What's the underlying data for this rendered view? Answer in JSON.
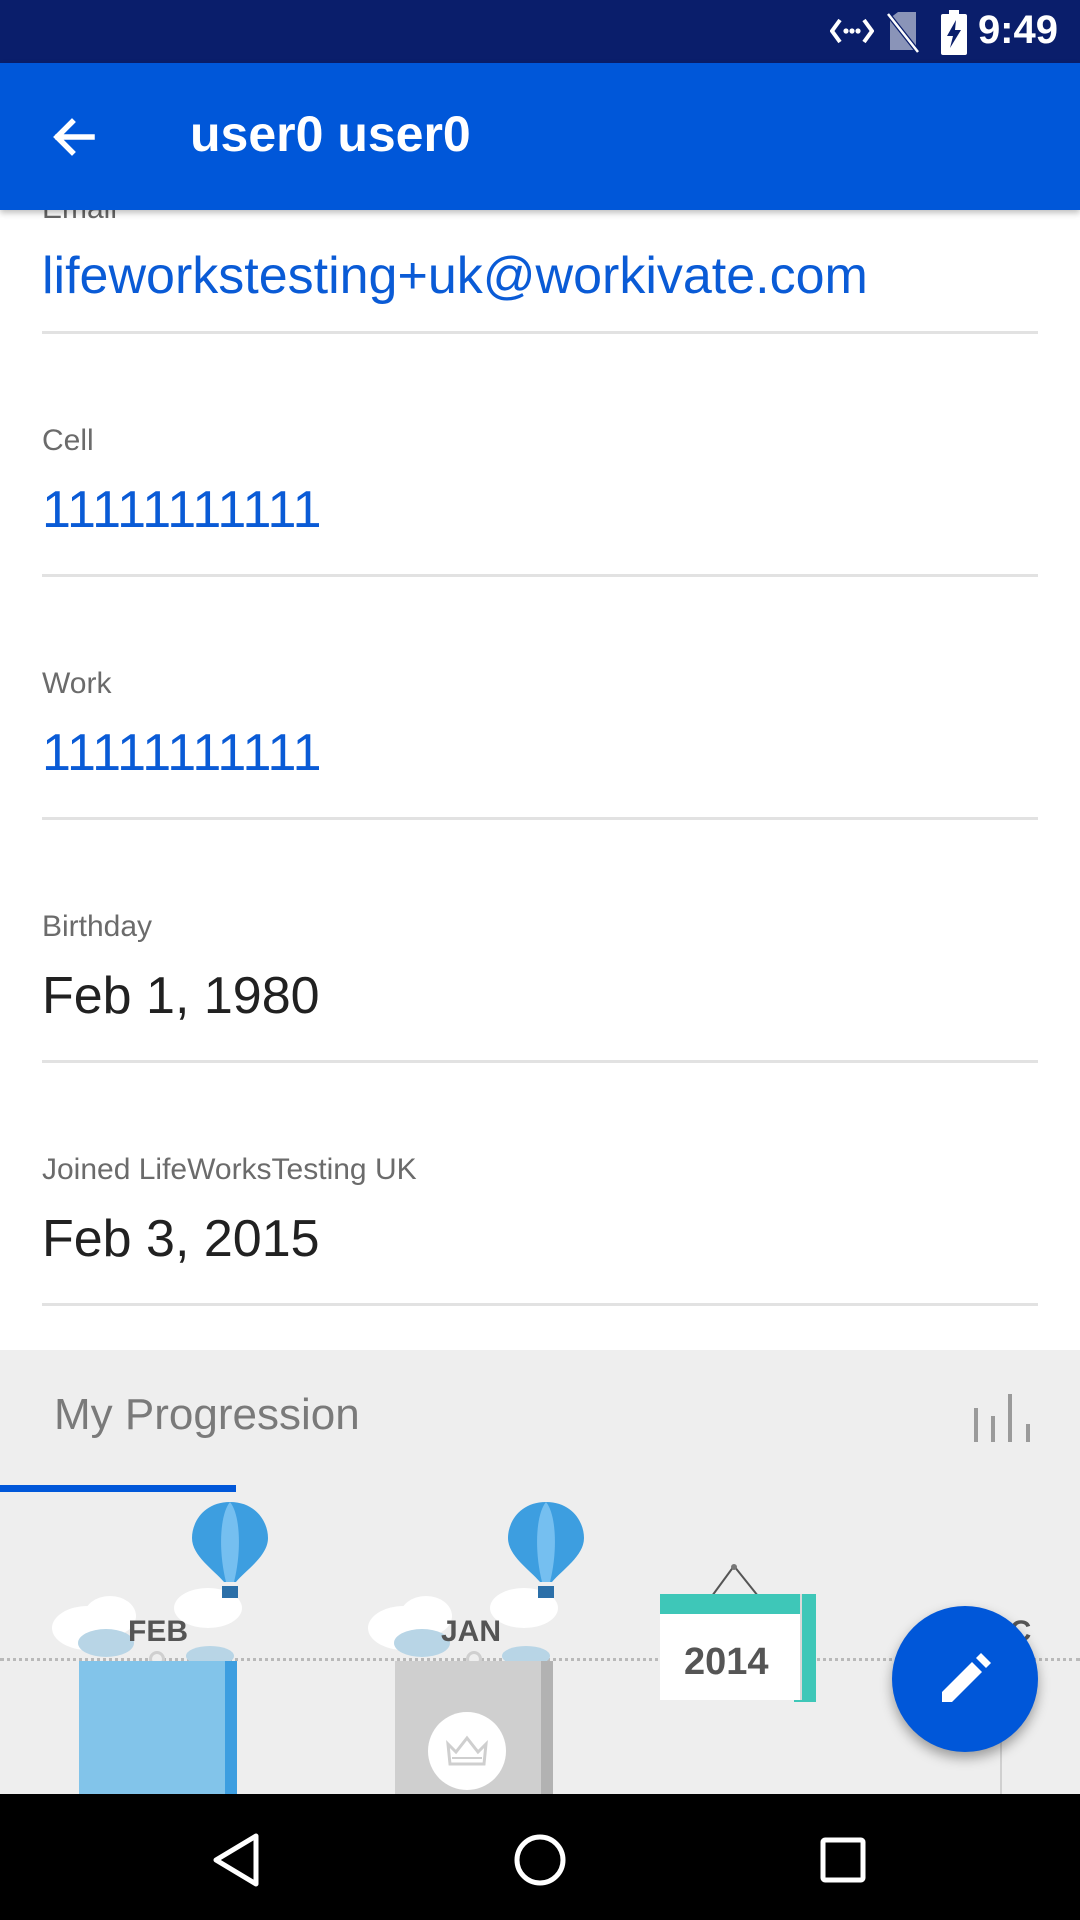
{
  "status_bar": {
    "time": "9:49",
    "icons": [
      "data-sync-icon",
      "no-sim-icon",
      "battery-charging-icon"
    ]
  },
  "app_bar": {
    "title": "user0 user0",
    "back_icon": "arrow-back-icon"
  },
  "profile": {
    "email": {
      "label": "Email",
      "value": "lifeworkstesting+uk@workivate.com"
    },
    "cell": {
      "label": "Cell",
      "value": "11111111111"
    },
    "work": {
      "label": "Work",
      "value": "11111111111"
    },
    "birthday": {
      "label": "Birthday",
      "value": "Feb 1, 1980"
    },
    "joined": {
      "label": "Joined LifeWorksTesting UK",
      "value": "Feb 3, 2015"
    }
  },
  "progression": {
    "title": "My Progression",
    "chart_icon": "bar-chart-icon",
    "timeline": [
      {
        "label": "FEB",
        "color": "#82c4ea"
      },
      {
        "label": "JAN",
        "color": "#cfcfcf"
      },
      {
        "label": "2014",
        "color": "#3ec7b8"
      },
      {
        "label": "DEC",
        "color": "#cfcfcf"
      }
    ]
  },
  "fab": {
    "icon": "edit-pencil-icon"
  },
  "nav_bar": {
    "buttons": [
      "back-triangle-icon",
      "home-circle-icon",
      "recents-square-icon"
    ]
  },
  "colors": {
    "primary": "#0057d9",
    "status_bar": "#0a1e6b",
    "link_text": "#0a5bd6",
    "balloon_blue": "#3d9ee0",
    "bar_blue": "#82c4ea",
    "calendar_teal": "#3ec7b8"
  }
}
